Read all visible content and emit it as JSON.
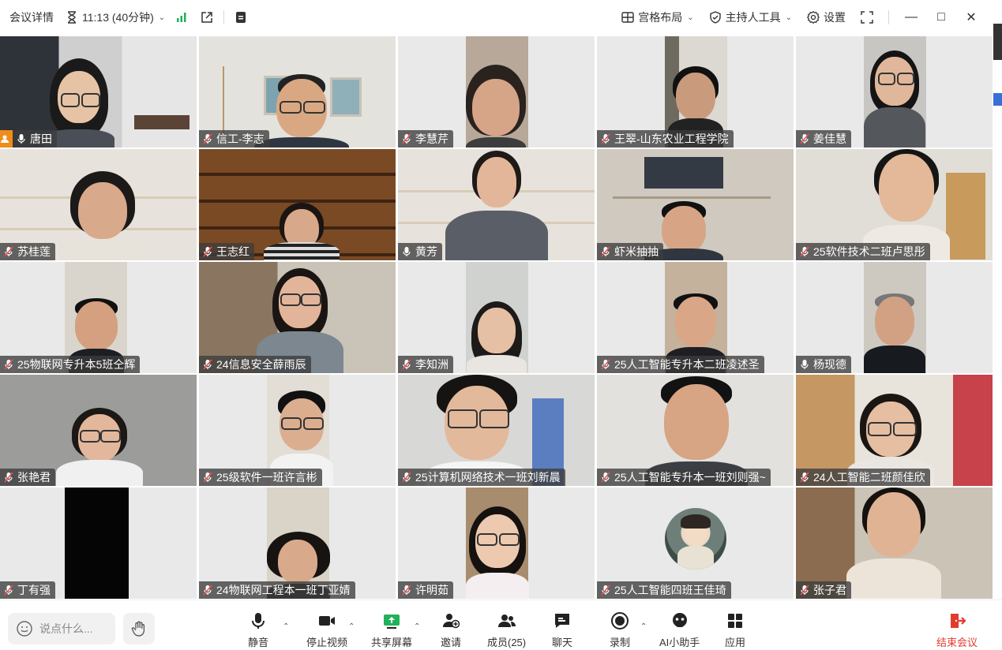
{
  "topbar": {
    "meeting_details": "会议详情",
    "time": "11:13 (40分钟)",
    "layout": "宫格布局",
    "host_tools": "主持人工具",
    "settings": "设置"
  },
  "participants": [
    {
      "name": "唐田",
      "host": true,
      "muted": false
    },
    {
      "name": "信工-李志",
      "muted": true
    },
    {
      "name": "李慧芹",
      "muted": true
    },
    {
      "name": "王翠-山东农业工程学院",
      "muted": true
    },
    {
      "name": "姜佳慧",
      "muted": true
    },
    {
      "name": "苏桂莲",
      "muted": true
    },
    {
      "name": "王志红",
      "muted": true
    },
    {
      "name": "黄芳",
      "muted": false
    },
    {
      "name": "虾米抽抽",
      "muted": true
    },
    {
      "name": "25软件技术二班卢思彤",
      "muted": true
    },
    {
      "name": "25物联网专升本5班仝辉",
      "muted": true
    },
    {
      "name": "24信息安全薛雨辰",
      "muted": true
    },
    {
      "name": "李知洲",
      "muted": true
    },
    {
      "name": "25人工智能专升本二班凌述圣",
      "muted": true
    },
    {
      "name": "杨现德",
      "muted": false
    },
    {
      "name": "张艳君",
      "muted": true
    },
    {
      "name": "25级软件一班许言彬",
      "muted": true
    },
    {
      "name": "25计算机网络技术一班刘新晨",
      "muted": true
    },
    {
      "name": "25人工智能专升本一班刘则强~",
      "muted": true
    },
    {
      "name": "24人工智能二班颜佳欣",
      "muted": true
    },
    {
      "name": "丁有强",
      "muted": true
    },
    {
      "name": "24物联网工程本一班丁亚婧",
      "muted": true
    },
    {
      "name": "许明茹",
      "muted": true
    },
    {
      "name": "25人工智能四班王佳琦",
      "muted": true
    },
    {
      "name": "张子君",
      "muted": true
    }
  ],
  "bottombar": {
    "chat_placeholder": "说点什么...",
    "mute": "静音",
    "stop_video": "停止视频",
    "share_screen": "共享屏幕",
    "invite": "邀请",
    "members": "成员(25)",
    "chat": "聊天",
    "record": "录制",
    "ai_assistant": "AI小助手",
    "apps": "应用",
    "end_meeting": "结束会议"
  },
  "colors": {
    "accent_green": "#20b15a",
    "end_red": "#e23b2c",
    "host_orange": "#f08c1a"
  }
}
